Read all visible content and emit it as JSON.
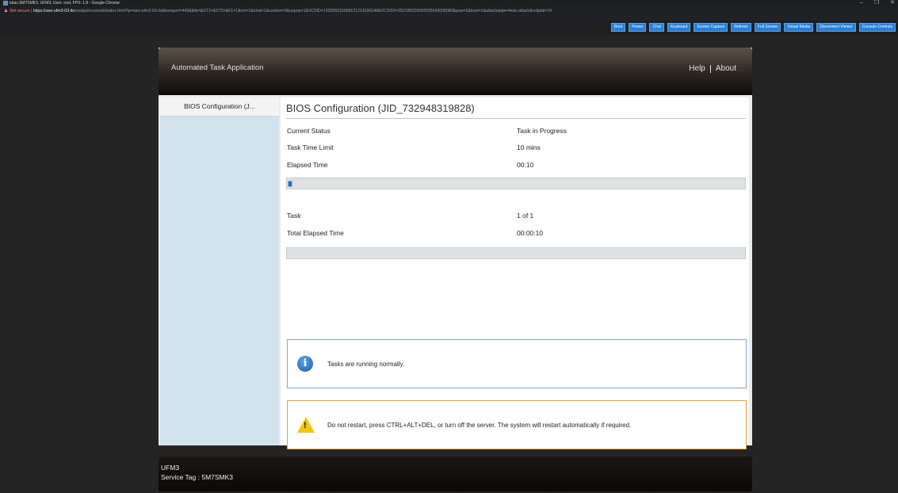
{
  "window": {
    "title": "idrac-5M7SMK3, UFM3, User: root, FPS: 1.8 - Google Chrome",
    "controls": [
      "–",
      "❐",
      "✕"
    ]
  },
  "address": {
    "not_secure": "Not secure",
    "url_host": "https://swx-ufm3-03-ilo",
    "url_rest": "/restgui/vconsole/index.html?ip=swx-ufm3-03-ilo&kvmport=443&title=&ST1=&ST2=&F1=1&vm=1&chat=1&custom=0&nopop=1&VCSID=132205015099121214100148&VCSID2=252185220093035043008080&pow=1&boot=1&attachstate=Auto-attach&vclipbit=1#"
  },
  "toolbar": {
    "buttons": [
      "Boot",
      "Power",
      "Chat",
      "Keyboard",
      "Screen Capture",
      "Refresh",
      "Full Screen",
      "Virtual Media",
      "Disconnect Viewer",
      "Console Controls"
    ]
  },
  "app": {
    "title": "Automated Task Application",
    "nav_help": "Help",
    "nav_about": "About"
  },
  "sidebar": {
    "items": [
      {
        "label": "BIOS Configuration (J..."
      }
    ]
  },
  "main": {
    "title": "BIOS Configuration (JID_732948319828)",
    "current_status_label": "Current Status",
    "current_status_value": "Task in Progress",
    "time_limit_label": "Task Time Limit",
    "time_limit_value": "10 mins",
    "elapsed_label": "Elapsed Time",
    "elapsed_value": "00:10",
    "progress_fraction": 0.01,
    "task_label": "Task",
    "task_value": "1 of 1",
    "total_elapsed_label": "Total Elapsed Time",
    "total_elapsed_value": "00:00:10",
    "overall_progress_fraction": 0
  },
  "messages": {
    "info": "Tasks are running normally.",
    "warning": "Do not restart, press CTRL+ALT+DEL, or turn off the server.  The system will restart automatically if required."
  },
  "footer": {
    "host": "UFM3",
    "service_tag": "Service Tag : 5M7SMK3"
  }
}
